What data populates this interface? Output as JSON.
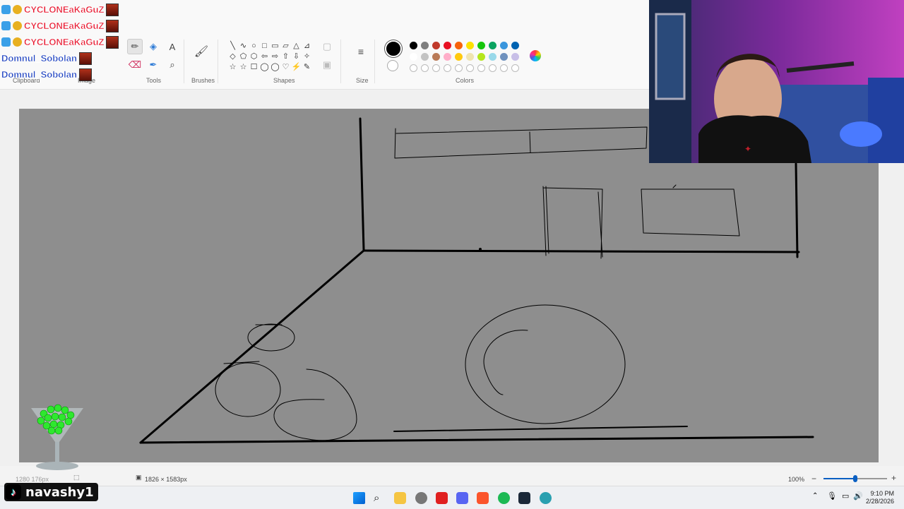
{
  "ribbon": {
    "groups": {
      "clipboard": "Clipboard",
      "image": "Image",
      "tools": "Tools",
      "brushes": "Brushes",
      "shapes": "Shapes",
      "size": "Size",
      "colors": "Colors"
    },
    "shape_icons": [
      "╲",
      "∿",
      "○",
      "□",
      "▭",
      "▱",
      "△",
      "⊿",
      "◇",
      "⬠",
      "⬡",
      "⇦",
      "⇨",
      "⇧",
      "⇩",
      "✧",
      "☆",
      "☆",
      "☐",
      "◯",
      "◯",
      "♡",
      "⚡",
      "✎"
    ],
    "palette_row1": [
      "#000000",
      "#7f7f7f",
      "#c0392b",
      "#e81123",
      "#f7630c",
      "#fce100",
      "#16c60c",
      "#0ba360",
      "#3a96dd",
      "#0063b1",
      "#8e44ad"
    ],
    "palette_row2": [
      "#ffffff",
      "#c3c3c3",
      "#b97a57",
      "#ffaec9",
      "#ffc90e",
      "#efe4b0",
      "#b5e61d",
      "#99d9ea",
      "#7092be",
      "#c8bfe7"
    ]
  },
  "chat": [
    {
      "name": "CYCLONEaKaGuZ",
      "color": "red"
    },
    {
      "name": "CYCLONEaKaGuZ",
      "color": "red"
    },
    {
      "name": "CYCLONEaKaGuZ",
      "color": "red"
    },
    {
      "name": "Domnul_Sobolan",
      "color": "blue"
    },
    {
      "name": "Domnul_Sobolan",
      "color": "blue"
    }
  ],
  "status": {
    "position": "1280 176px",
    "canvas_size": "1826 × 1583px",
    "zoom": "100%",
    "zoom_level": 0.5
  },
  "tiktok": {
    "handle": "navashy1"
  },
  "clock": {
    "time": "9:10 PM",
    "date": "2/28/2026"
  }
}
